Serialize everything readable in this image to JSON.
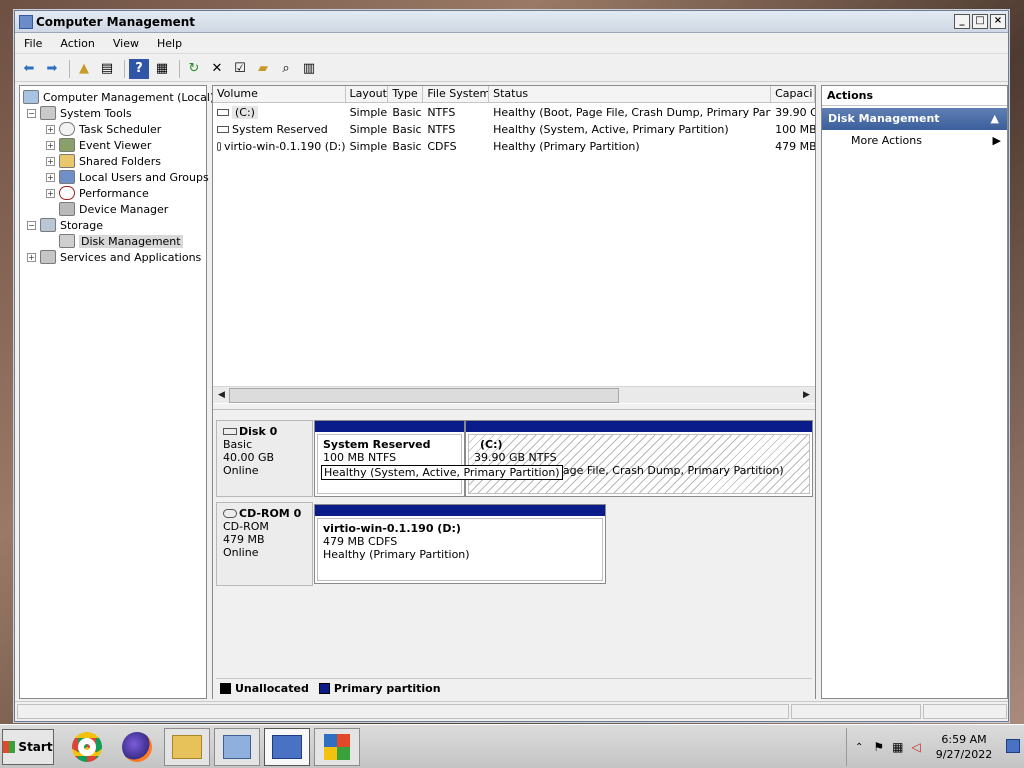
{
  "window": {
    "title": "Computer Management"
  },
  "menu": [
    "File",
    "Action",
    "View",
    "Help"
  ],
  "tree": [
    {
      "label": "Computer Management (Local)",
      "level": 0,
      "icon": "computer-icon"
    },
    {
      "label": "System Tools",
      "level": 1,
      "icon": "tools-icon",
      "expander": "−"
    },
    {
      "label": "Task Scheduler",
      "level": 2,
      "icon": "clock-icon",
      "expander": "+"
    },
    {
      "label": "Event Viewer",
      "level": 2,
      "icon": "event-viewer-icon",
      "expander": "+"
    },
    {
      "label": "Shared Folders",
      "level": 2,
      "icon": "shared-folder-icon",
      "expander": "+"
    },
    {
      "label": "Local Users and Groups",
      "level": 2,
      "icon": "users-icon",
      "expander": "+"
    },
    {
      "label": "Performance",
      "level": 2,
      "icon": "performance-icon",
      "expander": "+"
    },
    {
      "label": "Device Manager",
      "level": 2,
      "icon": "device-manager-icon"
    },
    {
      "label": "Storage",
      "level": 1,
      "icon": "storage-icon",
      "expander": "−"
    },
    {
      "label": "Disk Management",
      "level": 2,
      "icon": "disk-icon",
      "selected": true
    },
    {
      "label": "Services and Applications",
      "level": 1,
      "icon": "services-icon",
      "expander": "+"
    }
  ],
  "volume_table": {
    "columns": [
      "Volume",
      "Layout",
      "Type",
      "File System",
      "Status",
      "Capaci"
    ],
    "rows": [
      [
        "(C:)",
        "Simple",
        "Basic",
        "NTFS",
        "Healthy (Boot, Page File, Crash Dump, Primary Partition)",
        "39.90 G"
      ],
      [
        "System Reserved",
        "Simple",
        "Basic",
        "NTFS",
        "Healthy (System, Active, Primary Partition)",
        "100 MB"
      ],
      [
        "virtio-win-0.1.190 (D:)",
        "Simple",
        "Basic",
        "CDFS",
        "Healthy (Primary Partition)",
        "479 MB"
      ]
    ]
  },
  "disks": [
    {
      "name": "Disk 0",
      "kind": "Basic",
      "size": "40.00 GB",
      "state": "Online",
      "partitions": [
        {
          "name": "System Reserved",
          "size": "100 MB NTFS",
          "status": "Healthy (System, Active, Primary Partition)"
        },
        {
          "name": "(C:)",
          "size": "39.90 GB NTFS",
          "status": "Healthy (Boot, Page File, Crash Dump, Primary Partition)"
        }
      ]
    },
    {
      "name": "CD-ROM 0",
      "kind": "CD-ROM",
      "size": "479 MB",
      "state": "Online",
      "partitions": [
        {
          "name": "virtio-win-0.1.190  (D:)",
          "size": "479 MB CDFS",
          "status": "Healthy (Primary Partition)"
        }
      ]
    }
  ],
  "tooltip": "Healthy (System, Active, Primary Partition)",
  "legend": [
    {
      "label": "Unallocated",
      "color": "#000000"
    },
    {
      "label": "Primary partition",
      "color": "#0a1c8a"
    }
  ],
  "actions": {
    "header": "Actions",
    "section": "Disk Management",
    "items": [
      "More Actions"
    ]
  },
  "taskbar": {
    "start": "Start",
    "time": "6:59 AM",
    "date": "9/27/2022"
  }
}
